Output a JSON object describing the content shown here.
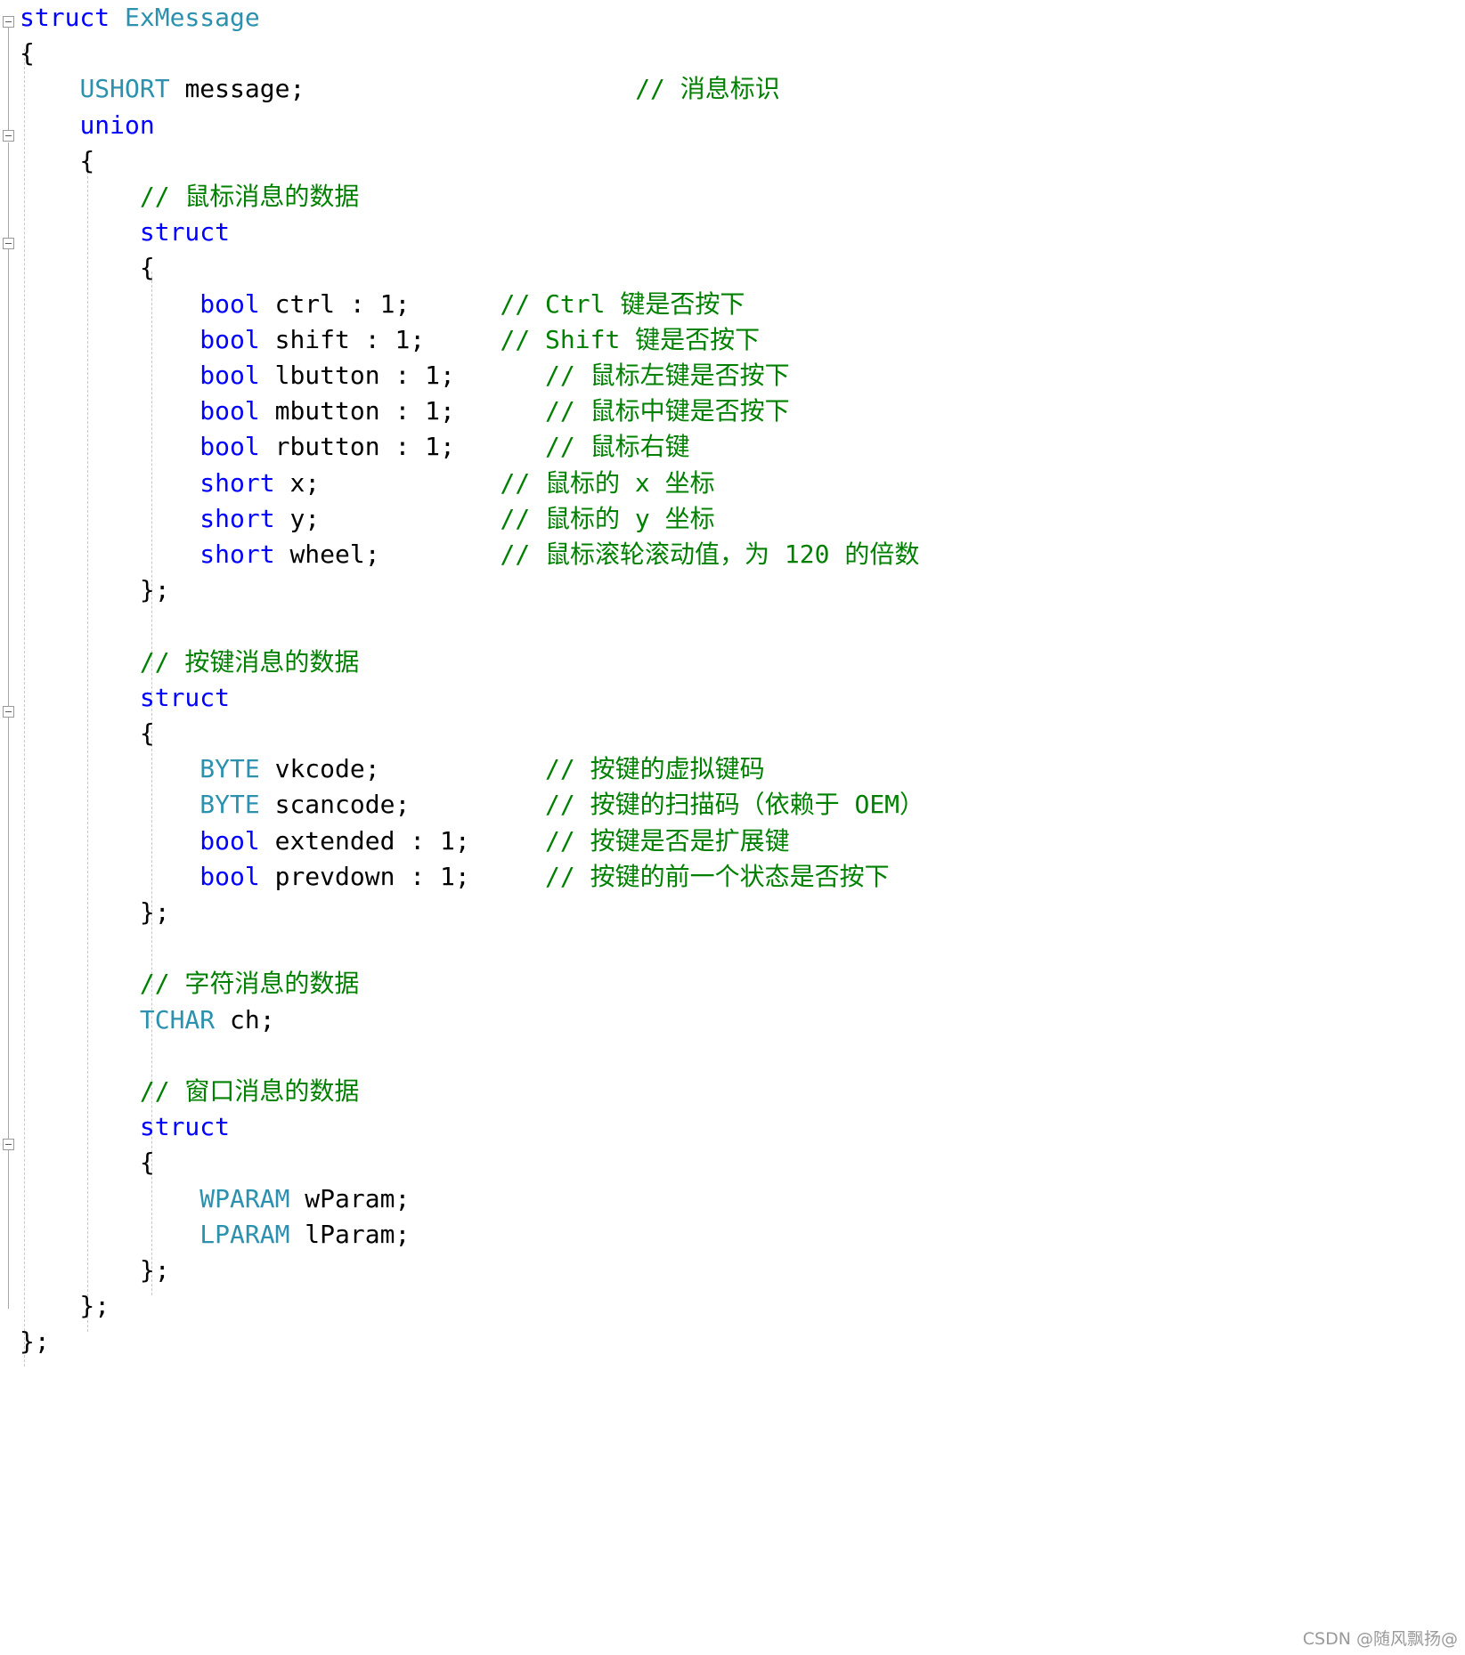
{
  "editor": {
    "language": "cpp",
    "colors": {
      "background": "#ffffff",
      "keyword": "#0000ff",
      "type": "#2b91af",
      "comment": "#008000",
      "identifier": "#000000",
      "gutter_line": "#a8a8a8",
      "indent_guide": "#c8c8c8",
      "watermark": "#9a9a9a"
    },
    "watermark": "CSDN @随风飘扬@"
  },
  "lines": [
    {
      "n": 1,
      "indent": 0,
      "fold": "open",
      "text": "struct ExMessage",
      "segs": [
        {
          "t": "struct",
          "c": "kw"
        },
        {
          "t": " ",
          "c": "pun"
        },
        {
          "t": "ExMessage",
          "c": "type"
        }
      ]
    },
    {
      "n": 2,
      "indent": 0,
      "text": "{",
      "segs": [
        {
          "t": "{",
          "c": "pun"
        }
      ]
    },
    {
      "n": 3,
      "indent": 1,
      "text": "USHORT message;                      // 消息标识",
      "segs": [
        {
          "t": "    ",
          "c": "pun"
        },
        {
          "t": "USHORT",
          "c": "type"
        },
        {
          "t": " message;",
          "c": "id"
        },
        {
          "t": "                      ",
          "c": "pun"
        },
        {
          "t": "// 消息标识",
          "c": "cmt"
        }
      ]
    },
    {
      "n": 4,
      "indent": 1,
      "fold": "open",
      "text": "union",
      "segs": [
        {
          "t": "    ",
          "c": "pun"
        },
        {
          "t": "union",
          "c": "kw"
        }
      ]
    },
    {
      "n": 5,
      "indent": 1,
      "text": "{",
      "segs": [
        {
          "t": "    {",
          "c": "pun"
        }
      ]
    },
    {
      "n": 6,
      "indent": 2,
      "text": "// 鼠标消息的数据",
      "segs": [
        {
          "t": "        ",
          "c": "pun"
        },
        {
          "t": "// 鼠标消息的数据",
          "c": "cmt"
        }
      ]
    },
    {
      "n": 7,
      "indent": 2,
      "fold": "open",
      "text": "struct",
      "segs": [
        {
          "t": "        ",
          "c": "pun"
        },
        {
          "t": "struct",
          "c": "kw"
        }
      ]
    },
    {
      "n": 8,
      "indent": 2,
      "text": "{",
      "segs": [
        {
          "t": "        {",
          "c": "pun"
        }
      ]
    },
    {
      "n": 9,
      "indent": 3,
      "text": "bool ctrl : 1;      // Ctrl 键是否按下",
      "segs": [
        {
          "t": "            ",
          "c": "pun"
        },
        {
          "t": "bool",
          "c": "kw"
        },
        {
          "t": " ctrl : 1;",
          "c": "id"
        },
        {
          "t": "      ",
          "c": "pun"
        },
        {
          "t": "// Ctrl 键是否按下",
          "c": "cmt"
        }
      ]
    },
    {
      "n": 10,
      "indent": 3,
      "text": "bool shift : 1;     // Shift 键是否按下",
      "segs": [
        {
          "t": "            ",
          "c": "pun"
        },
        {
          "t": "bool",
          "c": "kw"
        },
        {
          "t": " shift : 1;",
          "c": "id"
        },
        {
          "t": "     ",
          "c": "pun"
        },
        {
          "t": "// Shift 键是否按下",
          "c": "cmt"
        }
      ]
    },
    {
      "n": 11,
      "indent": 3,
      "text": "bool lbutton : 1;      // 鼠标左键是否按下",
      "segs": [
        {
          "t": "            ",
          "c": "pun"
        },
        {
          "t": "bool",
          "c": "kw"
        },
        {
          "t": " lbutton : 1;",
          "c": "id"
        },
        {
          "t": "      ",
          "c": "pun"
        },
        {
          "t": "// 鼠标左键是否按下",
          "c": "cmt"
        }
      ]
    },
    {
      "n": 12,
      "indent": 3,
      "text": "bool mbutton : 1;      // 鼠标中键是否按下",
      "segs": [
        {
          "t": "            ",
          "c": "pun"
        },
        {
          "t": "bool",
          "c": "kw"
        },
        {
          "t": " mbutton : 1;",
          "c": "id"
        },
        {
          "t": "      ",
          "c": "pun"
        },
        {
          "t": "// 鼠标中键是否按下",
          "c": "cmt"
        }
      ]
    },
    {
      "n": 13,
      "indent": 3,
      "text": "bool rbutton : 1;      // 鼠标右键",
      "segs": [
        {
          "t": "            ",
          "c": "pun"
        },
        {
          "t": "bool",
          "c": "kw"
        },
        {
          "t": " rbutton : 1;",
          "c": "id"
        },
        {
          "t": "      ",
          "c": "pun"
        },
        {
          "t": "// 鼠标右键",
          "c": "cmt"
        }
      ]
    },
    {
      "n": 14,
      "indent": 3,
      "text": "short x;            // 鼠标的 x 坐标",
      "segs": [
        {
          "t": "            ",
          "c": "pun"
        },
        {
          "t": "short",
          "c": "kw"
        },
        {
          "t": " x;",
          "c": "id"
        },
        {
          "t": "            ",
          "c": "pun"
        },
        {
          "t": "// 鼠标的 x 坐标",
          "c": "cmt"
        }
      ]
    },
    {
      "n": 15,
      "indent": 3,
      "text": "short y;            // 鼠标的 y 坐标",
      "segs": [
        {
          "t": "            ",
          "c": "pun"
        },
        {
          "t": "short",
          "c": "kw"
        },
        {
          "t": " y;",
          "c": "id"
        },
        {
          "t": "            ",
          "c": "pun"
        },
        {
          "t": "// 鼠标的 y 坐标",
          "c": "cmt"
        }
      ]
    },
    {
      "n": 16,
      "indent": 3,
      "text": "short wheel;        // 鼠标滚轮滚动值，为 120 的倍数",
      "segs": [
        {
          "t": "            ",
          "c": "pun"
        },
        {
          "t": "short",
          "c": "kw"
        },
        {
          "t": " wheel;",
          "c": "id"
        },
        {
          "t": "        ",
          "c": "pun"
        },
        {
          "t": "// 鼠标滚轮滚动值，为 120 的倍数",
          "c": "cmt"
        }
      ]
    },
    {
      "n": 17,
      "indent": 2,
      "text": "};",
      "segs": [
        {
          "t": "        };",
          "c": "pun"
        }
      ]
    },
    {
      "n": 18,
      "indent": 2,
      "text": "",
      "segs": [
        {
          "t": "",
          "c": "pun"
        }
      ]
    },
    {
      "n": 19,
      "indent": 2,
      "text": "// 按键消息的数据",
      "segs": [
        {
          "t": "        ",
          "c": "pun"
        },
        {
          "t": "// 按键消息的数据",
          "c": "cmt"
        }
      ]
    },
    {
      "n": 20,
      "indent": 2,
      "fold": "open",
      "text": "struct",
      "segs": [
        {
          "t": "        ",
          "c": "pun"
        },
        {
          "t": "struct",
          "c": "kw"
        }
      ]
    },
    {
      "n": 21,
      "indent": 2,
      "text": "{",
      "segs": [
        {
          "t": "        {",
          "c": "pun"
        }
      ]
    },
    {
      "n": 22,
      "indent": 3,
      "text": "BYTE vkcode;           // 按键的虚拟键码",
      "segs": [
        {
          "t": "            ",
          "c": "pun"
        },
        {
          "t": "BYTE",
          "c": "type"
        },
        {
          "t": " vkcode;",
          "c": "id"
        },
        {
          "t": "           ",
          "c": "pun"
        },
        {
          "t": "// 按键的虚拟键码",
          "c": "cmt"
        }
      ]
    },
    {
      "n": 23,
      "indent": 3,
      "text": "BYTE scancode;         // 按键的扫描码（依赖于 OEM）",
      "segs": [
        {
          "t": "            ",
          "c": "pun"
        },
        {
          "t": "BYTE",
          "c": "type"
        },
        {
          "t": " scancode;",
          "c": "id"
        },
        {
          "t": "         ",
          "c": "pun"
        },
        {
          "t": "// 按键的扫描码（依赖于 OEM）",
          "c": "cmt"
        }
      ]
    },
    {
      "n": 24,
      "indent": 3,
      "text": "bool extended : 1;     // 按键是否是扩展键",
      "segs": [
        {
          "t": "            ",
          "c": "pun"
        },
        {
          "t": "bool",
          "c": "kw"
        },
        {
          "t": " extended : 1;",
          "c": "id"
        },
        {
          "t": "     ",
          "c": "pun"
        },
        {
          "t": "// 按键是否是扩展键",
          "c": "cmt"
        }
      ]
    },
    {
      "n": 25,
      "indent": 3,
      "text": "bool prevdown : 1;     // 按键的前一个状态是否按下",
      "segs": [
        {
          "t": "            ",
          "c": "pun"
        },
        {
          "t": "bool",
          "c": "kw"
        },
        {
          "t": " prevdown : 1;",
          "c": "id"
        },
        {
          "t": "     ",
          "c": "pun"
        },
        {
          "t": "// 按键的前一个状态是否按下",
          "c": "cmt"
        }
      ]
    },
    {
      "n": 26,
      "indent": 2,
      "text": "};",
      "segs": [
        {
          "t": "        };",
          "c": "pun"
        }
      ]
    },
    {
      "n": 27,
      "indent": 2,
      "text": "",
      "segs": [
        {
          "t": "",
          "c": "pun"
        }
      ]
    },
    {
      "n": 28,
      "indent": 2,
      "text": "// 字符消息的数据",
      "segs": [
        {
          "t": "        ",
          "c": "pun"
        },
        {
          "t": "// 字符消息的数据",
          "c": "cmt"
        }
      ]
    },
    {
      "n": 29,
      "indent": 2,
      "text": "TCHAR ch;",
      "segs": [
        {
          "t": "        ",
          "c": "pun"
        },
        {
          "t": "TCHAR",
          "c": "type"
        },
        {
          "t": " ch;",
          "c": "id"
        }
      ]
    },
    {
      "n": 30,
      "indent": 2,
      "text": "",
      "segs": [
        {
          "t": "",
          "c": "pun"
        }
      ]
    },
    {
      "n": 31,
      "indent": 2,
      "text": "// 窗口消息的数据",
      "segs": [
        {
          "t": "        ",
          "c": "pun"
        },
        {
          "t": "// 窗口消息的数据",
          "c": "cmt"
        }
      ]
    },
    {
      "n": 32,
      "indent": 2,
      "fold": "open",
      "text": "struct",
      "segs": [
        {
          "t": "        ",
          "c": "pun"
        },
        {
          "t": "struct",
          "c": "kw"
        }
      ]
    },
    {
      "n": 33,
      "indent": 2,
      "text": "{",
      "segs": [
        {
          "t": "        {",
          "c": "pun"
        }
      ]
    },
    {
      "n": 34,
      "indent": 3,
      "text": "WPARAM wParam;",
      "segs": [
        {
          "t": "            ",
          "c": "pun"
        },
        {
          "t": "WPARAM",
          "c": "type"
        },
        {
          "t": " wParam;",
          "c": "id"
        }
      ]
    },
    {
      "n": 35,
      "indent": 3,
      "text": "LPARAM lParam;",
      "segs": [
        {
          "t": "            ",
          "c": "pun"
        },
        {
          "t": "LPARAM",
          "c": "type"
        },
        {
          "t": " lParam;",
          "c": "id"
        }
      ]
    },
    {
      "n": 36,
      "indent": 2,
      "text": "};",
      "segs": [
        {
          "t": "        };",
          "c": "pun"
        }
      ]
    },
    {
      "n": 37,
      "indent": 1,
      "text": "};",
      "segs": [
        {
          "t": "    };",
          "c": "pun"
        }
      ]
    },
    {
      "n": 38,
      "indent": 0,
      "text": "};",
      "segs": [
        {
          "t": "};",
          "c": "pun"
        }
      ]
    }
  ]
}
